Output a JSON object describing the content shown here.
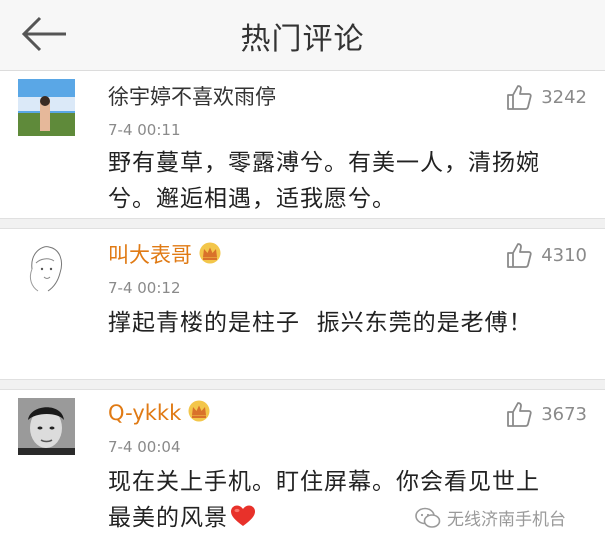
{
  "header": {
    "title": "热门评论",
    "back_icon": "back-arrow-icon"
  },
  "comments": [
    {
      "user": "徐宇婷不喜欢雨停",
      "time": "7-4 00:11",
      "likes": "3242",
      "text_lines": [
        "野有蔓草，零露溥兮。有美一人，清扬婉",
        "兮。邂逅相遇，适我愿兮。"
      ],
      "vip": false
    },
    {
      "user": "叫大表哥",
      "time": "7-4 00:12",
      "likes": "4310",
      "text_lines": [
        "撑起青楼的是柱子  振兴东莞的是老傅！"
      ],
      "vip": true
    },
    {
      "user": "Q-ykkk",
      "time": "7-4 00:04",
      "likes": "3673",
      "text_lines": [
        "现在关上手机。盯住屏幕。你会看见世上",
        "最美的风景"
      ],
      "vip": true
    }
  ],
  "watermark": {
    "text": "无线济南手机台"
  },
  "colors": {
    "vip_name": "#e07a14",
    "heart": "#e8312a",
    "header_bg": "#f7f7f7"
  }
}
